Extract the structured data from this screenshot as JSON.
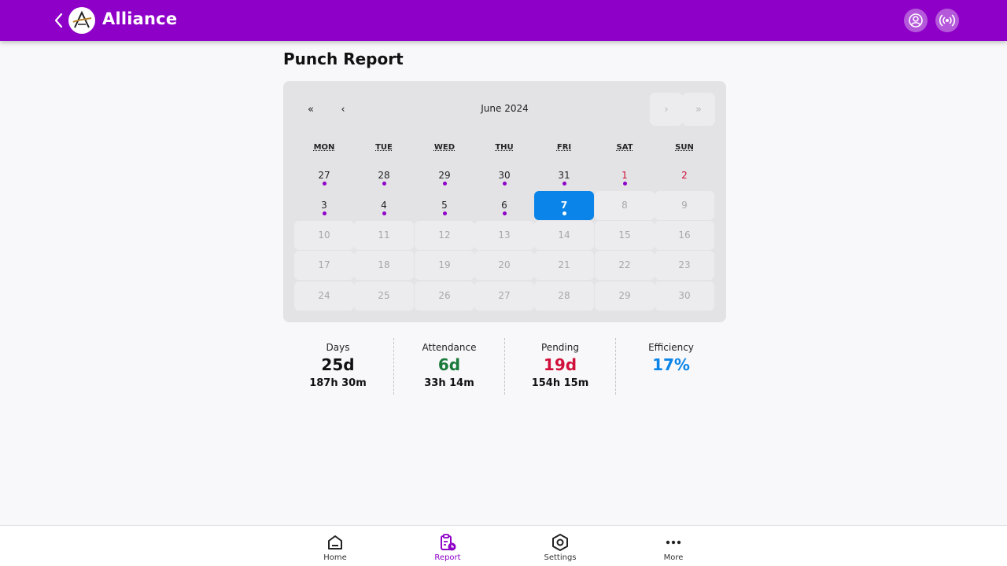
{
  "header": {
    "app_title": "Alliance",
    "logo_letter": "A",
    "back_icon": "chevron-left-icon",
    "profile_icon": "user-circle-icon",
    "broadcast_icon": "broadcast-icon",
    "bar_color": "#8e00c8"
  },
  "page": {
    "title": "Punch Report"
  },
  "calendar": {
    "month_label": "June 2024",
    "nav": {
      "first": "«",
      "prev": "‹",
      "next": "›",
      "last": "»"
    },
    "weekdays": [
      "MON",
      "TUE",
      "WED",
      "THU",
      "FRI",
      "SAT",
      "SUN"
    ],
    "weeks": [
      [
        {
          "n": "27",
          "dot": true
        },
        {
          "n": "28",
          "dot": true
        },
        {
          "n": "29",
          "dot": true
        },
        {
          "n": "30",
          "dot": true
        },
        {
          "n": "31",
          "dot": true
        },
        {
          "n": "1",
          "dot": true,
          "weekend": true
        },
        {
          "n": "2",
          "weekend": true
        }
      ],
      [
        {
          "n": "3",
          "dot": true
        },
        {
          "n": "4",
          "dot": true
        },
        {
          "n": "5",
          "dot": true
        },
        {
          "n": "6",
          "dot": true
        },
        {
          "n": "7",
          "dot": true,
          "selected": true
        },
        {
          "n": "8",
          "dim": true
        },
        {
          "n": "9",
          "dim": true
        }
      ],
      [
        {
          "n": "10",
          "dim": true
        },
        {
          "n": "11",
          "dim": true
        },
        {
          "n": "12",
          "dim": true
        },
        {
          "n": "13",
          "dim": true
        },
        {
          "n": "14",
          "dim": true
        },
        {
          "n": "15",
          "dim": true
        },
        {
          "n": "16",
          "dim": true
        }
      ],
      [
        {
          "n": "17",
          "dim": true
        },
        {
          "n": "18",
          "dim": true
        },
        {
          "n": "19",
          "dim": true
        },
        {
          "n": "20",
          "dim": true
        },
        {
          "n": "21",
          "dim": true
        },
        {
          "n": "22",
          "dim": true
        },
        {
          "n": "23",
          "dim": true
        }
      ],
      [
        {
          "n": "24",
          "dim": true
        },
        {
          "n": "25",
          "dim": true
        },
        {
          "n": "26",
          "dim": true
        },
        {
          "n": "27",
          "dim": true
        },
        {
          "n": "28",
          "dim": true
        },
        {
          "n": "29",
          "dim": true
        },
        {
          "n": "30",
          "dim": true
        }
      ]
    ],
    "colors": {
      "selected": "#0a84e8",
      "dot": "#8e00c8",
      "weekend": "#d0103a"
    }
  },
  "stats": [
    {
      "label": "Days",
      "value": "25d",
      "sub": "187h 30m",
      "color": "#111111"
    },
    {
      "label": "Attendance",
      "value": "6d",
      "sub": "33h 14m",
      "color": "#1a7a3a"
    },
    {
      "label": "Pending",
      "value": "19d",
      "sub": "154h 15m",
      "color": "#d0103a"
    },
    {
      "label": "Efficiency",
      "value": "17%",
      "sub": "",
      "color": "#0a84e8"
    }
  ],
  "bottom_nav": [
    {
      "label": "Home",
      "icon": "home-icon",
      "active": false
    },
    {
      "label": "Report",
      "icon": "report-clipboard-icon",
      "active": true
    },
    {
      "label": "Settings",
      "icon": "settings-hex-icon",
      "active": false
    },
    {
      "label": "More",
      "icon": "more-dots-icon",
      "active": false
    }
  ]
}
